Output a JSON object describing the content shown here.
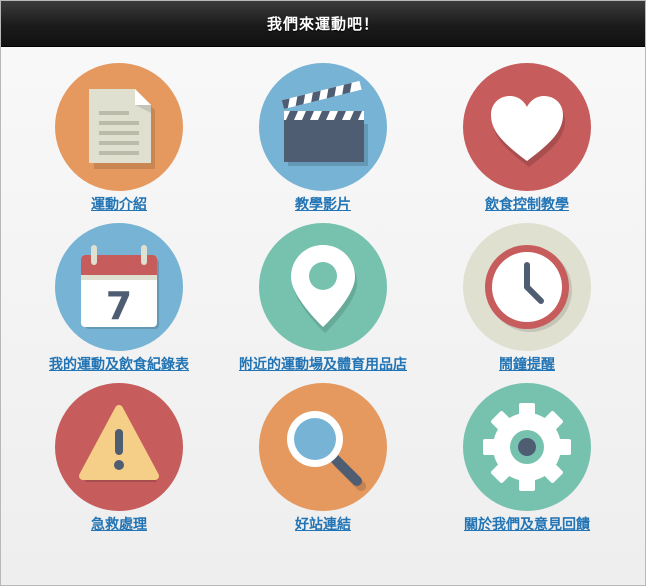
{
  "header": {
    "title": "我們來運動吧！"
  },
  "menu": {
    "items": [
      {
        "label": "運動介紹",
        "icon": "document-icon",
        "color": "#E5995F"
      },
      {
        "label": "教學影片",
        "icon": "clapperboard-icon",
        "color": "#77B3D4"
      },
      {
        "label": "飲食控制教學",
        "icon": "heart-icon",
        "color": "#C75C5C"
      },
      {
        "label": "我的運動及飲食紀錄表",
        "icon": "calendar-icon",
        "calendar_day": "7",
        "color": "#77B3D4"
      },
      {
        "label": "附近的運動場及體育用品店",
        "icon": "map-pin-icon",
        "color": "#76C2AF"
      },
      {
        "label": "鬧鐘提醒",
        "icon": "clock-icon",
        "color": "#E0E0D1"
      },
      {
        "label": "急救處理",
        "icon": "warning-icon",
        "color": "#C75C5C"
      },
      {
        "label": "好站連結",
        "icon": "magnifier-icon",
        "color": "#E5995F"
      },
      {
        "label": "關於我們及意見回饋",
        "icon": "gear-icon",
        "color": "#76C2AF"
      }
    ]
  }
}
